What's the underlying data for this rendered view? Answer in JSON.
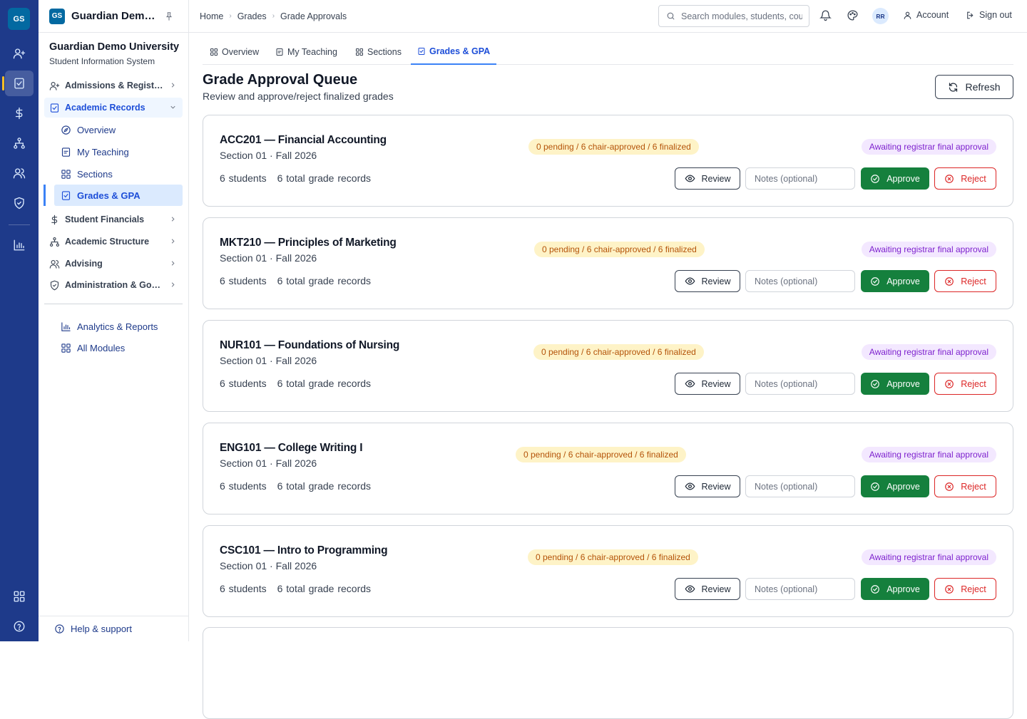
{
  "rail": {
    "logo": "GS",
    "items": [
      "user-plus-icon",
      "clipboard-check-icon",
      "dollar-icon",
      "hierarchy-icon",
      "users-icon",
      "shield-check-icon",
      "bar-chart-icon"
    ],
    "bottom": [
      "grid-icon",
      "help-circle-icon"
    ],
    "active_color": "#fbbf24"
  },
  "sidebar": {
    "badge": "GS",
    "app_title": "Guardian Demo University",
    "university": "Guardian Demo University",
    "system": "Student Information System",
    "items": [
      {
        "label": "Admissions & Registration",
        "icon": "user-plus-icon"
      },
      {
        "label": "Academic Records",
        "icon": "clipboard-check-icon"
      },
      {
        "label": "Student Financials",
        "icon": "dollar-icon"
      },
      {
        "label": "Academic Structure",
        "icon": "hierarchy-icon"
      },
      {
        "label": "Advising",
        "icon": "users-icon"
      },
      {
        "label": "Administration & Governance",
        "icon": "shield-check-icon"
      }
    ],
    "subitems": [
      {
        "label": "Overview",
        "icon": "compass-icon"
      },
      {
        "label": "My Teaching",
        "icon": "clipboard-icon"
      },
      {
        "label": "Sections",
        "icon": "grid-icon"
      },
      {
        "label": "Grades & GPA",
        "icon": "clipboard-check-icon"
      }
    ],
    "extra": [
      {
        "label": "Analytics & Reports",
        "icon": "bar-chart-icon"
      },
      {
        "label": "All Modules",
        "icon": "grid-icon"
      }
    ],
    "help": "Help & support"
  },
  "topbar": {
    "breadcrumbs": [
      "Home",
      "Grades",
      "Grade Approvals"
    ],
    "search_placeholder": "Search modules, students, courses",
    "avatar": "RR",
    "account": "Account",
    "signout": "Sign out"
  },
  "tabs": [
    {
      "label": "Overview"
    },
    {
      "label": "My Teaching"
    },
    {
      "label": "Sections"
    },
    {
      "label": "Grades & GPA"
    }
  ],
  "page": {
    "title": "Grade Approval Queue",
    "subtitle": "Review and approve/reject finalized grades",
    "refresh": "Refresh"
  },
  "actions": {
    "review": "Review",
    "notes_placeholder": "Notes (optional)",
    "approve": "Approve",
    "reject": "Reject"
  },
  "colors": {
    "rail_bg": "#1e3a8a",
    "accent": "#1d4ed8",
    "approve": "#15803d",
    "reject": "#dc2626",
    "pending_pill": "#fef3c7",
    "status_pill": "#f3e8ff"
  },
  "cards": [
    {
      "title": "ACC201 — Financial Accounting",
      "section": "Section 01 · Fall 2026",
      "students": "6 students",
      "records": "6 total grade records",
      "counts": "0 pending / 6 chair-approved / 6 finalized",
      "status": "Awaiting registrar final approval"
    },
    {
      "title": "MKT210 — Principles of Marketing",
      "section": "Section 01 · Fall 2026",
      "students": "6 students",
      "records": "6 total grade records",
      "counts": "0 pending / 6 chair-approved / 6 finalized",
      "status": "Awaiting registrar final approval"
    },
    {
      "title": "NUR101 — Foundations of Nursing",
      "section": "Section 01 · Fall 2026",
      "students": "6 students",
      "records": "6 total grade records",
      "counts": "0 pending / 6 chair-approved / 6 finalized",
      "status": "Awaiting registrar final approval"
    },
    {
      "title": "ENG101 — College Writing I",
      "section": "Section 01 · Fall 2026",
      "students": "6 students",
      "records": "6 total grade records",
      "counts": "0 pending / 6 chair-approved / 6 finalized",
      "status": "Awaiting registrar final approval"
    },
    {
      "title": "CSC101 — Intro to Programming",
      "section": "Section 01 · Fall 2026",
      "students": "6 students",
      "records": "6 total grade records",
      "counts": "0 pending / 6 chair-approved / 6 finalized",
      "status": "Awaiting registrar final approval"
    }
  ]
}
